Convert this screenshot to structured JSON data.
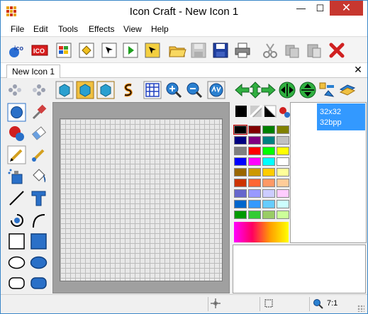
{
  "window": {
    "title": "Icon Craft - New Icon 1",
    "min_glyph": "—",
    "max_glyph": "☐",
    "close_glyph": "✕"
  },
  "menu": [
    "File",
    "Edit",
    "Tools",
    "Effects",
    "View",
    "Help"
  ],
  "toolbar": {
    "ico_label": "ICO",
    "ico_label_small": "ico"
  },
  "tabs": [
    {
      "label": "New Icon 1"
    }
  ],
  "tab_close": "✕",
  "sizes": {
    "selected": {
      "size": "32x32",
      "depth": "32bpp"
    }
  },
  "status": {
    "zoom": "7:1"
  },
  "colors": {
    "accent": "#3399ff",
    "close": "#c7372f"
  },
  "palette": [
    [
      "#000000",
      "#800000",
      "#008000",
      "#808000"
    ],
    [
      "#000080",
      "#800080",
      "#008080",
      "#c0c0c0"
    ],
    [
      "#808080",
      "#ff0000",
      "#00ff00",
      "#ffff00"
    ],
    [
      "#0000ff",
      "#ff00ff",
      "#00ffff",
      "#ffffff"
    ],
    [
      "#996600",
      "#cc9900",
      "#ffcc00",
      "#ffff99"
    ],
    [
      "#cc3300",
      "#ff6633",
      "#ff9966",
      "#ffcc99"
    ],
    [
      "#6666cc",
      "#9999ff",
      "#ccccff",
      "#ffccff"
    ],
    [
      "#0066cc",
      "#3399ff",
      "#66ccff",
      "#ccffff"
    ],
    [
      "#009900",
      "#33cc33",
      "#99cc66",
      "#ccff99"
    ]
  ]
}
